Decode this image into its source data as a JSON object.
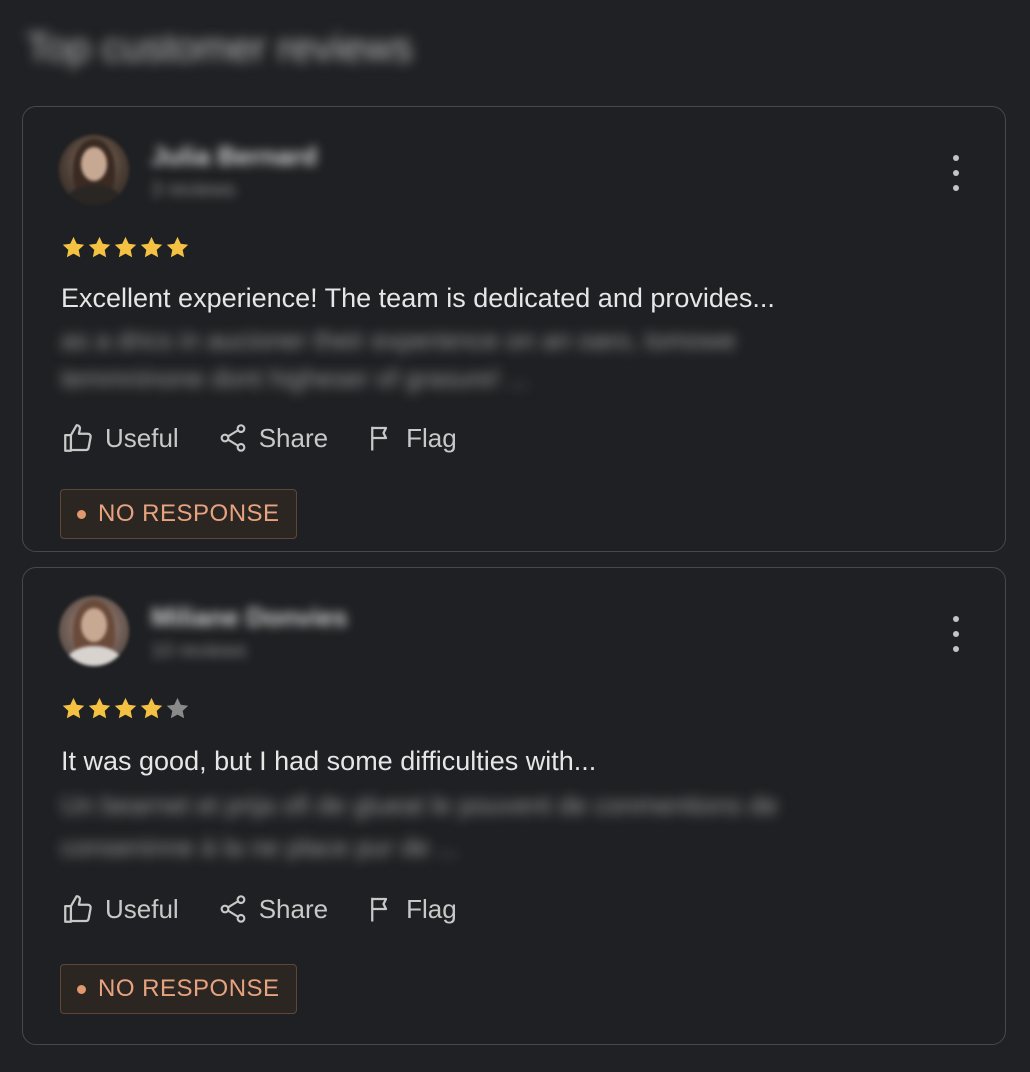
{
  "section": {
    "title": "Top customer reviews"
  },
  "reviews": [
    {
      "reviewer_name": "Julia Bernard",
      "reviewer_meta": "3 reviews",
      "rating": 5,
      "rating_max": 5,
      "text": "Excellent experience! The team is dedicated and provides...",
      "hidden_text_line1": "as a drics in aucioner their experience on an oaro, tomowe",
      "hidden_text_line2": "temmninone dont higheser of grasure! ...",
      "actions": {
        "useful": "Useful",
        "share": "Share",
        "flag": "Flag"
      },
      "status": "NO RESPONSE"
    },
    {
      "reviewer_name": "Miliane Donvies",
      "reviewer_meta": "10 reviews",
      "rating": 4,
      "rating_max": 5,
      "text": "It was good, but I had some difficulties with...",
      "hidden_text_line1": "Un bearnet et prija ofi de glueat le pouvent de conmentions de",
      "hidden_text_line2": "conseninne à la ne place pur de ...",
      "actions": {
        "useful": "Useful",
        "share": "Share",
        "flag": "Flag"
      },
      "status": "NO RESPONSE"
    }
  ],
  "colors": {
    "background": "#202124",
    "card_border": "#46484c",
    "star_filled": "#f5c142",
    "star_empty": "#8a8a8a",
    "badge_text": "#e7a37f"
  }
}
